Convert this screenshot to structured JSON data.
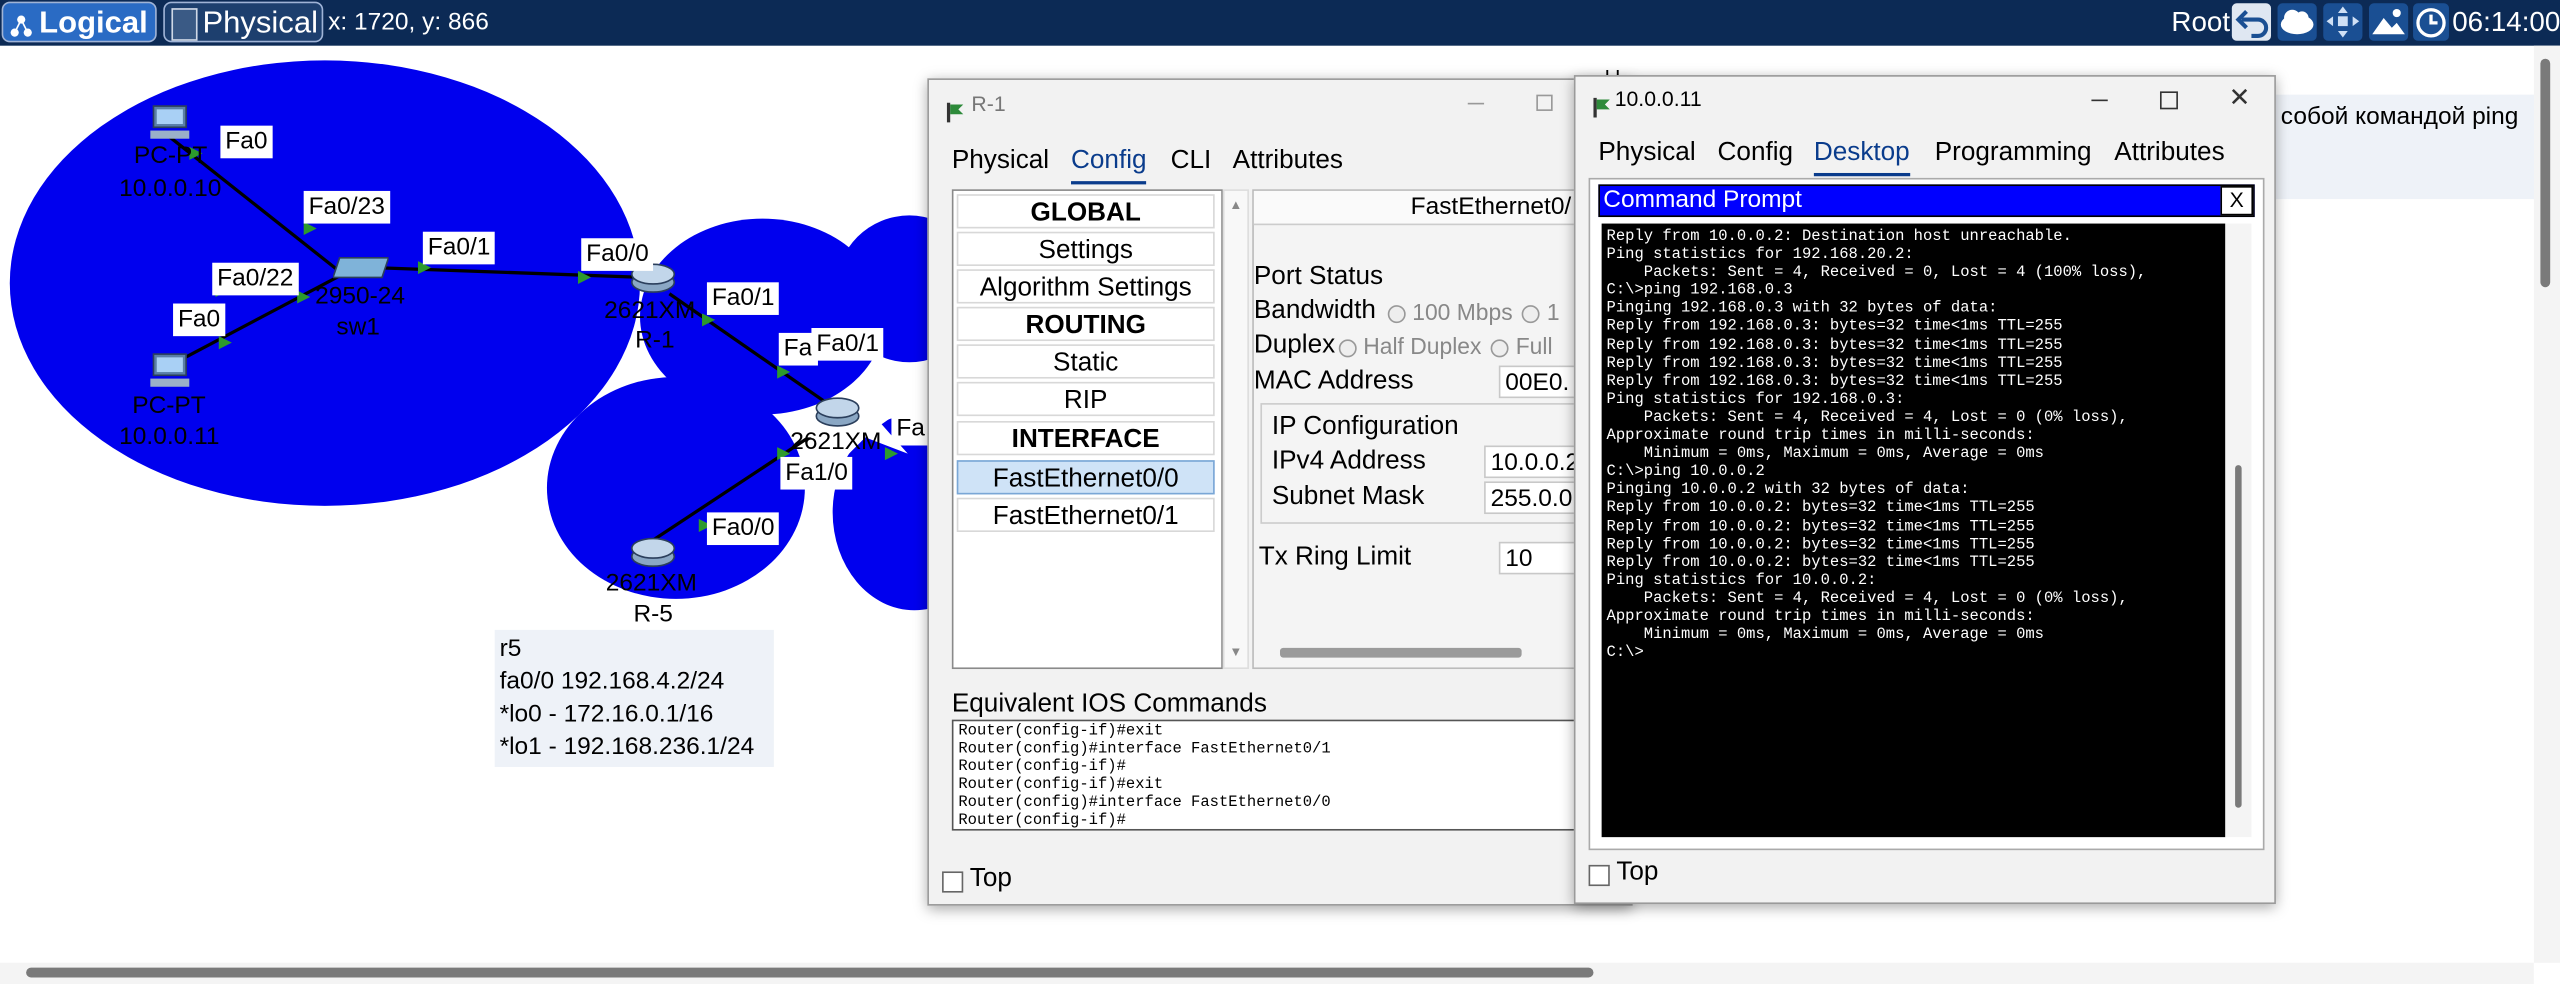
{
  "topbar": {
    "logical_label": "Logical",
    "physical_label": "Physical",
    "coordinates": "x: 1720, y: 866",
    "root_label": "Root",
    "clock": "06:14:00",
    "icons": [
      "back-icon",
      "cloud-icon",
      "move-icon",
      "image-icon",
      "network-clock-icon"
    ]
  },
  "topology": {
    "labels": {
      "fa0_pc1": "Fa0",
      "fa0_23": "Fa0/23",
      "fa0_1_sw": "Fa0/1",
      "fa0_0_r1": "Fa0/0",
      "fa0_22": "Fa0/22",
      "fa0_pc2": "Fa0",
      "fa0_1_r1": "Fa0/1",
      "fa_partial": "Fa",
      "fa0_1_r2": "Fa0/1",
      "fa_partial2": "Fa",
      "fa1_0": "Fa1/0",
      "fa0_0_r5": "Fa0/0"
    },
    "devices": {
      "pc1_type": "PC-PT",
      "pc1_ip": "10.0.0.10",
      "pc2_type": "PC-PT",
      "pc2_ip": "10.0.0.11",
      "sw_model": "2950-24",
      "sw_name": "sw1",
      "r1_model": "2621XM",
      "r1_name": "R-1",
      "r_mid_model": "2621XM",
      "r5_model": "2621XM",
      "r5_name": "R-5"
    },
    "note_lines": [
      "r5",
      "fa0/0 192.168.4.2/24",
      "*lo0 - 172.16.0.1/16",
      "*lo1 - 192.168.236.1/24"
    ],
    "background_text": "собой командой ping",
    "background_text2": "ы"
  },
  "r1_window": {
    "title": "R-1",
    "tabs": [
      "Physical",
      "Config",
      "CLI",
      "Attributes"
    ],
    "active_tab": "Config",
    "sidebar": [
      {
        "label": "GLOBAL",
        "header": true
      },
      {
        "label": "Settings"
      },
      {
        "label": "Algorithm Settings"
      },
      {
        "label": "ROUTING",
        "header": true
      },
      {
        "label": "Static"
      },
      {
        "label": "RIP"
      },
      {
        "label": "INTERFACE",
        "header": true
      },
      {
        "label": "FastEthernet0/0",
        "selected": true
      },
      {
        "label": "FastEthernet0/1"
      }
    ],
    "panel_title": "FastEthernet0/",
    "port_status_label": "Port Status",
    "bandwidth_label": "Bandwidth",
    "bandwidth_option": "100 Mbps",
    "bandwidth_option2": "1",
    "duplex_label": "Duplex",
    "duplex_half": "Half Duplex",
    "duplex_full": "Full",
    "mac_label": "MAC Address",
    "mac_value": "00E0.",
    "ip_config_label": "IP Configuration",
    "ipv4_label": "IPv4 Address",
    "ipv4_value": "10.0.0.2",
    "mask_label": "Subnet Mask",
    "mask_value": "255.0.0.",
    "tx_label": "Tx Ring Limit",
    "tx_value": "10",
    "ios_title": "Equivalent IOS Commands",
    "ios_lines": [
      "Router(config-if)#exit",
      "Router(config)#interface FastEthernet0/1",
      "Router(config-if)#",
      "Router(config-if)#exit",
      "Router(config)#interface FastEthernet0/0",
      "Router(config-if)#"
    ],
    "top_label": "Top"
  },
  "pc_window": {
    "title": "10.0.0.11",
    "tabs": [
      "Physical",
      "Config",
      "Desktop",
      "Programming",
      "Attributes"
    ],
    "active_tab": "Desktop",
    "cmd_title": "Command Prompt",
    "cmd_close": "X",
    "cmd_lines": [
      "Reply from 10.0.0.2: Destination host unreachable.",
      "",
      "Ping statistics for 192.168.20.2:",
      "    Packets: Sent = 4, Received = 0, Lost = 4 (100% loss),",
      "",
      "C:\\>ping 192.168.0.3",
      "",
      "Pinging 192.168.0.3 with 32 bytes of data:",
      "",
      "Reply from 192.168.0.3: bytes=32 time<1ms TTL=255",
      "Reply from 192.168.0.3: bytes=32 time<1ms TTL=255",
      "Reply from 192.168.0.3: bytes=32 time<1ms TTL=255",
      "Reply from 192.168.0.3: bytes=32 time<1ms TTL=255",
      "",
      "Ping statistics for 192.168.0.3:",
      "    Packets: Sent = 4, Received = 4, Lost = 0 (0% loss),",
      "Approximate round trip times in milli-seconds:",
      "    Minimum = 0ms, Maximum = 0ms, Average = 0ms",
      "",
      "C:\\>ping 10.0.0.2",
      "",
      "Pinging 10.0.0.2 with 32 bytes of data:",
      "",
      "Reply from 10.0.0.2: bytes=32 time<1ms TTL=255",
      "Reply from 10.0.0.2: bytes=32 time<1ms TTL=255",
      "Reply from 10.0.0.2: bytes=32 time<1ms TTL=255",
      "Reply from 10.0.0.2: bytes=32 time<1ms TTL=255",
      "",
      "Ping statistics for 10.0.0.2:",
      "    Packets: Sent = 4, Received = 4, Lost = 0 (0% loss),",
      "Approximate round trip times in milli-seconds:",
      "    Minimum = 0ms, Maximum = 0ms, Average = 0ms",
      "",
      "C:\\>"
    ],
    "top_label": "Top"
  },
  "colors": {
    "topbar_bg": "#0c2a55",
    "network_blob": "#0000ee",
    "cmd_bg": "#000000",
    "cmd_titlebar": "#0000ff",
    "active_tab": "#0a3c8c"
  }
}
